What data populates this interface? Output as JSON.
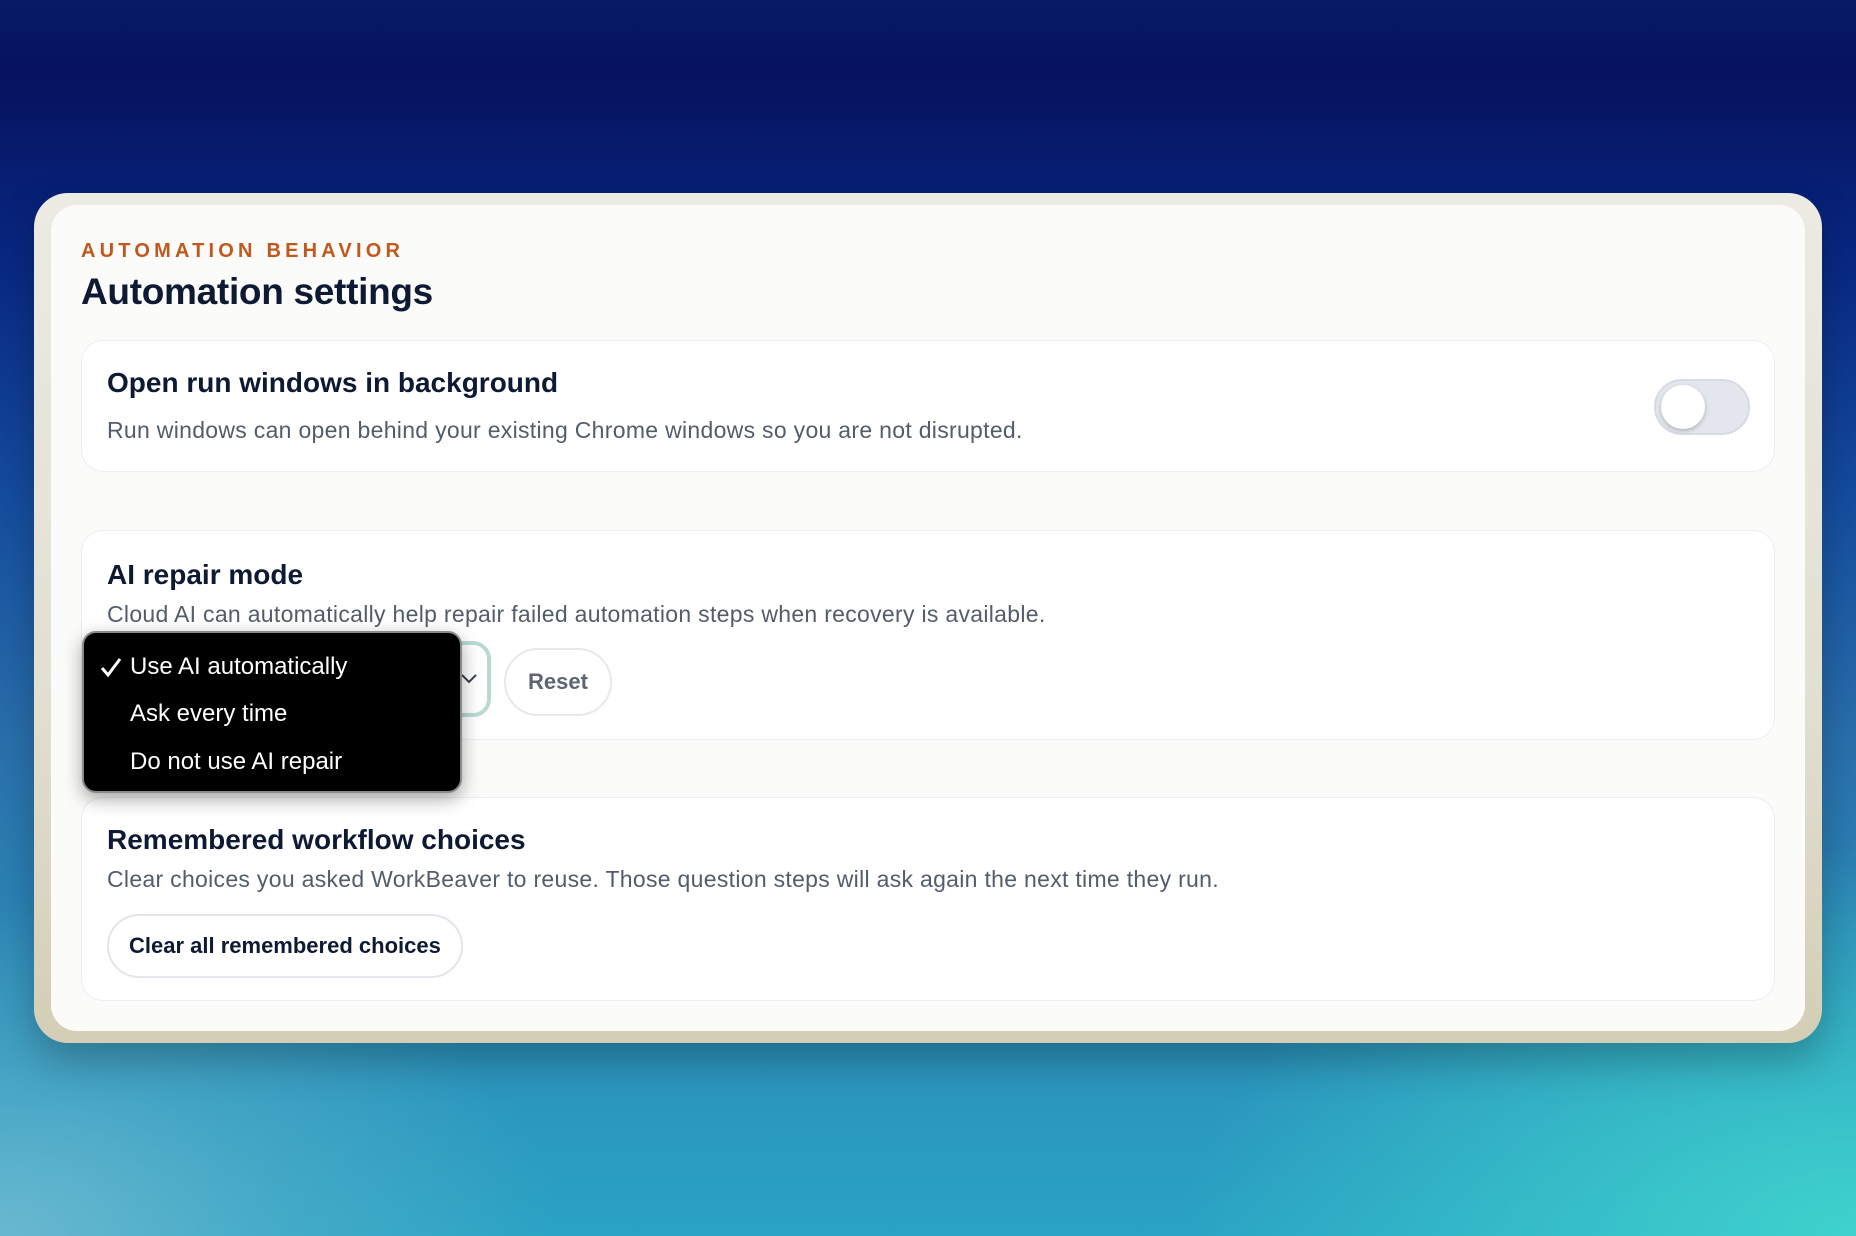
{
  "section": {
    "eyebrow": "AUTOMATION BEHAVIOR",
    "title": "Automation settings"
  },
  "background_windows": {
    "title": "Open run windows in background",
    "description": "Run windows can open behind your existing Chrome windows so you are not disrupted.",
    "enabled": false
  },
  "ai_repair": {
    "title": "AI repair mode",
    "description": "Cloud AI can automatically help repair failed automation steps when recovery is available.",
    "selected": "Use AI automatically",
    "options": [
      {
        "label": "Use AI automatically",
        "checked": true
      },
      {
        "label": "Ask every time",
        "checked": false
      },
      {
        "label": "Do not use AI repair",
        "checked": false
      }
    ],
    "reset_label": "Reset"
  },
  "remembered_choices": {
    "title": "Remembered workflow choices",
    "description": "Clear choices you asked WorkBeaver to reuse. Those question steps will ask again the next time they run.",
    "clear_label": "Clear all remembered choices"
  },
  "colors": {
    "eyebrow": "#c2581e",
    "heading": "#0e1a33",
    "select_focus_ring": "#b9dad3",
    "menu_background": "#000000"
  },
  "icons": {
    "check": "checkmark-icon",
    "chevron": "chevron-down-icon"
  }
}
